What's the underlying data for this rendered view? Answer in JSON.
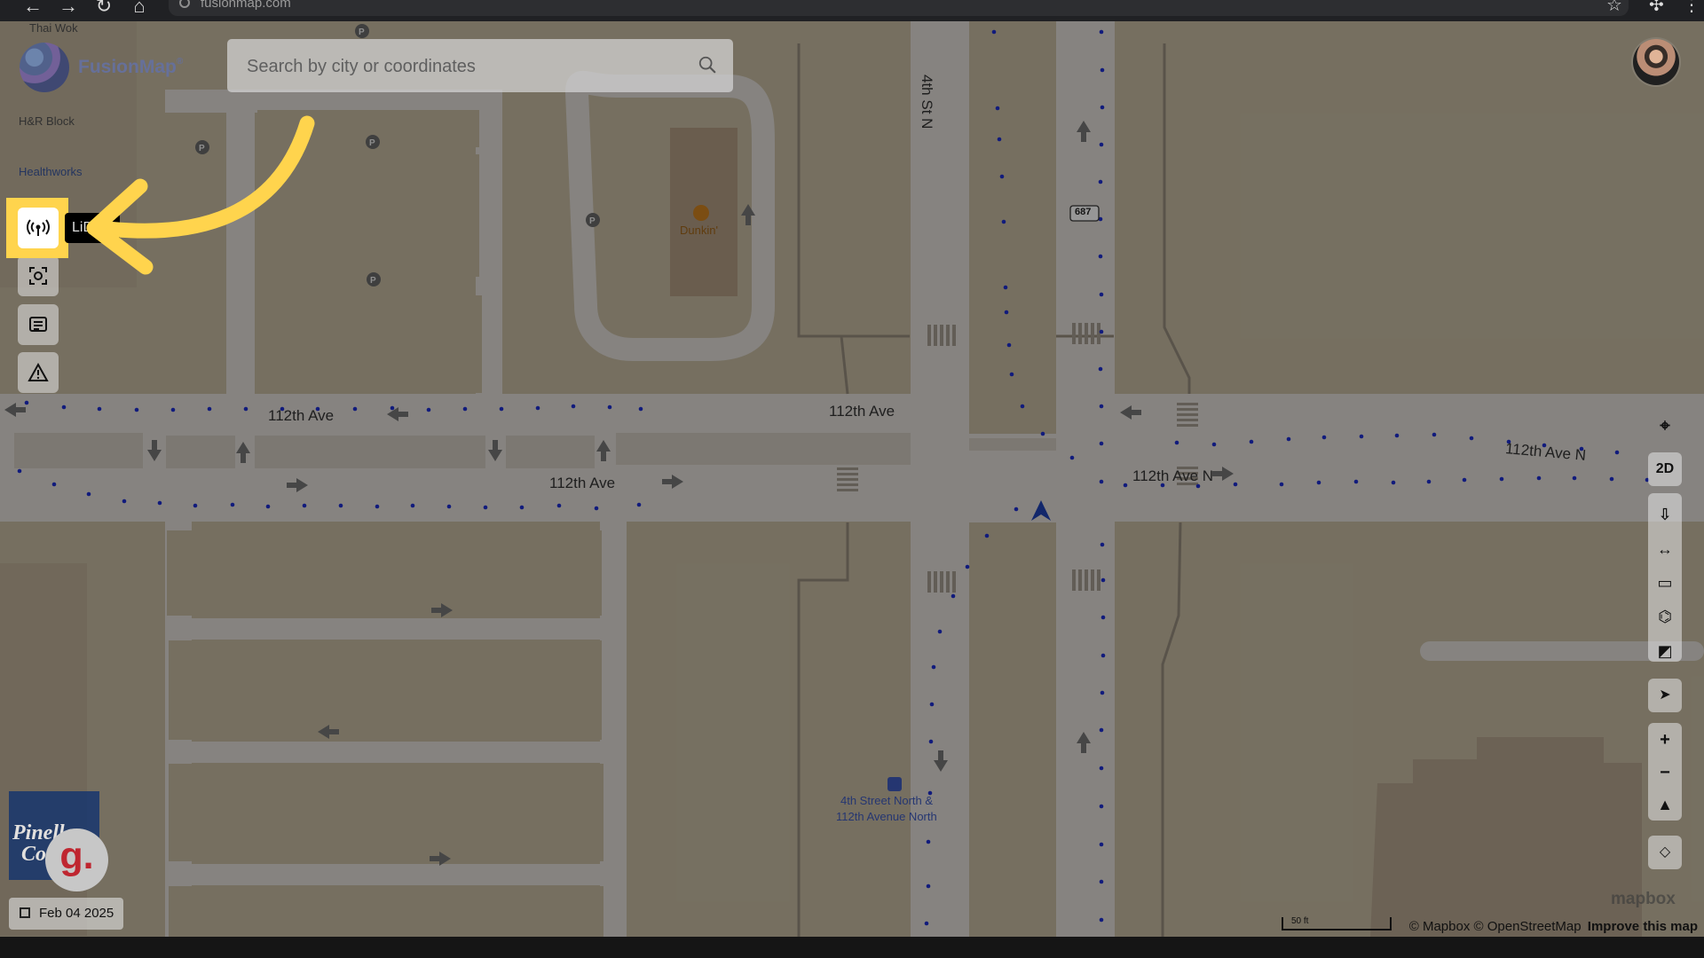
{
  "browser": {
    "url": "fusionmap.com",
    "back_icon": "arrow-left-icon",
    "forward_icon": "arrow-right-icon",
    "reload_icon": "reload-icon",
    "home_icon": "home-icon",
    "bookmark_icon": "star-icon",
    "extensions_icon": "puzzle-icon",
    "menu_icon": "more-vertical-icon"
  },
  "app": {
    "brand": "FusionMap",
    "registered": "®",
    "search_placeholder": "Search by city or coordinates",
    "search_value": "",
    "lidar_tooltip": "LiD",
    "date": "Feb 04 2025",
    "colors": {
      "map_base": "#bfb49c",
      "road": "#d8d4cf",
      "highlight": "#ffd44d",
      "route_dots": "#1c2cc8"
    }
  },
  "map": {
    "places": {
      "thai_wok": "Thai Wok",
      "hr_block": "H&R Block",
      "healthworks": "Healthworks",
      "dunkin": "Dunkin'",
      "bus_stop_line1": "4th Street North &",
      "bus_stop_line2": "112th Avenue North"
    },
    "roads": {
      "north_south": "4th St N",
      "avenue_1": "112th Ave",
      "avenue_2": "112th Ave",
      "avenue_3": "112th Ave",
      "avenue_4": "112th Ave N",
      "avenue_5": "112th Ave N",
      "route_number": "687"
    },
    "parking_label": "P",
    "scale_label": "50 ft",
    "attribution": "© Mapbox © OpenStreetMap",
    "improve_link": "Improve this map",
    "watermark": "mapbox"
  },
  "right_controls": {
    "view_mode": "2D"
  }
}
